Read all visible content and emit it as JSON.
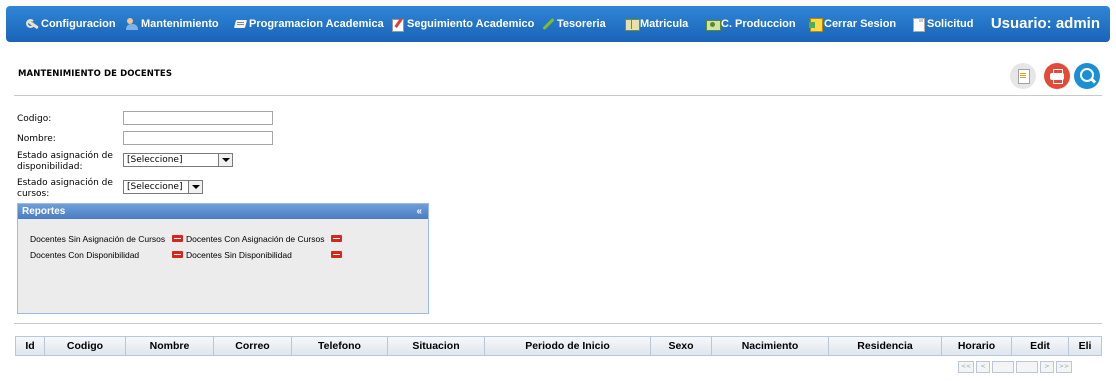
{
  "nav": {
    "items": [
      {
        "label": "Configuracion",
        "icon": "wrench-icon"
      },
      {
        "label": "Mantenimiento",
        "icon": "users-icon"
      },
      {
        "label": "Programacion Academica",
        "icon": "graduation-icon"
      },
      {
        "label": "Seguimiento Academico",
        "icon": "notepad-icon"
      },
      {
        "label": "Tesoreria",
        "icon": "pen-icon"
      },
      {
        "label": "Matricula",
        "icon": "book-icon"
      },
      {
        "label": "C. Produccion",
        "icon": "money-icon"
      },
      {
        "label": "Cerrar Sesion",
        "icon": "exit-door-icon"
      },
      {
        "label": "Solicitud",
        "icon": "document-icon"
      }
    ],
    "user_label": "Usuario:  admin"
  },
  "page": {
    "title": "MANTENIMIENTO DE DOCENTES"
  },
  "form": {
    "codigo_label": "Codigo:",
    "codigo_value": "",
    "nombre_label": "Nombre:",
    "nombre_value": "",
    "disp_label_1": "Estado asignación de",
    "disp_label_2": "disponibilidad:",
    "disp_selected": "[Seleccione]",
    "cursos_label_1": "Estado asignación de",
    "cursos_label_2": "cursos:",
    "cursos_selected": "[Seleccione]"
  },
  "reports": {
    "title": "Reportes",
    "collapse": "«",
    "links": [
      "Docentes Sin Asignación de Cursos",
      "Docentes Con Asignación de Cursos",
      "Docentes Con Disponibilidad",
      "Docentes Sin Disponibilidad"
    ]
  },
  "table": {
    "columns": [
      "Id",
      "Codigo",
      "Nombre",
      "Correo",
      "Telefono",
      "Situacion",
      "Periodo de Inicio",
      "Sexo",
      "Nacimiento",
      "Residencia",
      "Horario",
      "Edit",
      "Eli"
    ]
  },
  "pager": {
    "first": "<<",
    "prev": "<",
    "next": ">",
    "last": ">>"
  },
  "colors": {
    "nav_bg": "#1a63b8",
    "print_button": "#e34a3a",
    "search_button": "#1a8fd6",
    "panel_header": "#4a7cc4"
  }
}
